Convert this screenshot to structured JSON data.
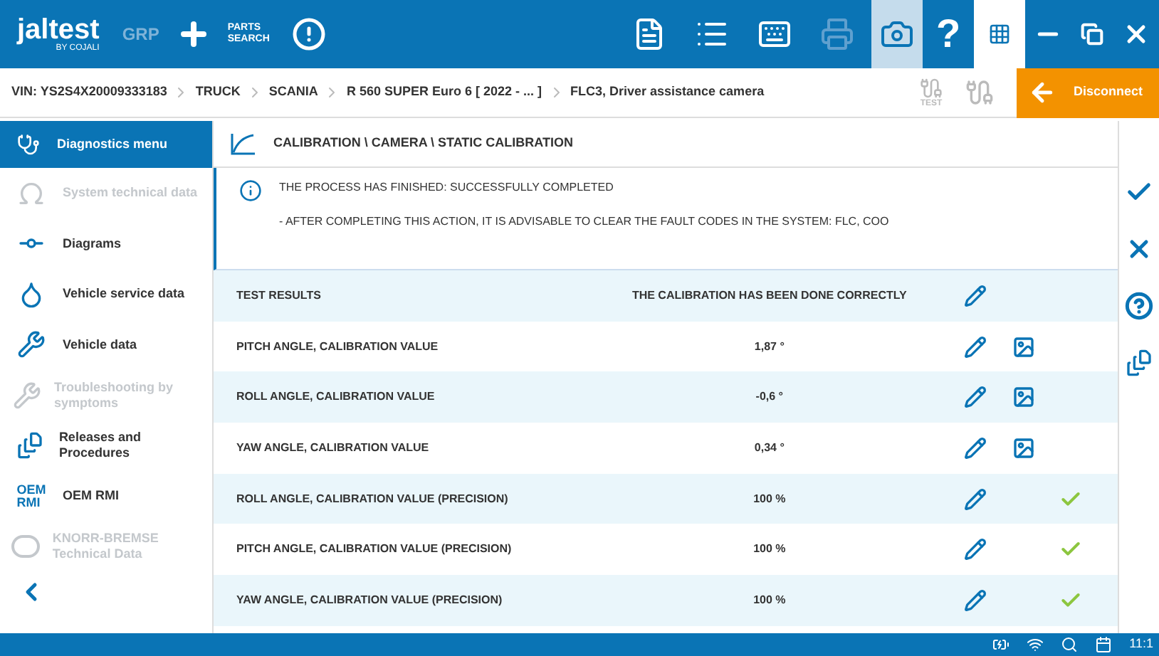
{
  "topbar": {
    "logo": "jaltest",
    "logo_sub": "BY COJALI",
    "grp": "GRP",
    "parts_search": [
      "PARTS",
      "SEARCH"
    ]
  },
  "breadcrumb": [
    "VIN: YS2S4X20009333183",
    "TRUCK",
    "SCANIA",
    "R 560 SUPER Euro 6 [ 2022 - ... ]",
    "FLC3, Driver assistance camera"
  ],
  "test_label": "TEST",
  "disconnect": "Disconnect",
  "sidebar": {
    "title": "Diagnostics menu",
    "items": [
      {
        "label": "System technical data",
        "disabled": true
      },
      {
        "label": "Diagrams",
        "disabled": false
      },
      {
        "label": "Vehicle service data",
        "disabled": false
      },
      {
        "label": "Vehicle data",
        "disabled": false
      },
      {
        "label": "Troubleshooting by symptoms",
        "disabled": true
      },
      {
        "label": "Releases and Procedures",
        "disabled": false
      },
      {
        "label": "OEM RMI",
        "icon_text": [
          "OEM",
          "RMI"
        ],
        "disabled": false
      },
      {
        "label": "KNORR-BREMSE Technical Data",
        "disabled": true
      }
    ]
  },
  "path": "CALIBRATION \\ CAMERA \\ STATIC CALIBRATION",
  "info": [
    "THE PROCESS HAS FINISHED: SUCCESSFULLY COMPLETED",
    "- AFTER COMPLETING THIS ACTION, IT IS ADVISABLE TO CLEAR THE FAULT CODES IN THE SYSTEM: FLC, COO"
  ],
  "results": [
    {
      "name": "TEST RESULTS",
      "value": "THE CALIBRATION HAS BEEN DONE CORRECTLY",
      "image": false,
      "passed": false
    },
    {
      "name": "PITCH ANGLE, CALIBRATION VALUE",
      "value": "1,87 °",
      "image": true,
      "passed": false
    },
    {
      "name": "ROLL ANGLE, CALIBRATION VALUE",
      "value": "-0,6 °",
      "image": true,
      "passed": false
    },
    {
      "name": "YAW ANGLE, CALIBRATION VALUE",
      "value": "0,34 °",
      "image": true,
      "passed": false
    },
    {
      "name": "ROLL ANGLE, CALIBRATION VALUE (PRECISION)",
      "value": "100 %",
      "image": false,
      "passed": true
    },
    {
      "name": "PITCH ANGLE, CALIBRATION VALUE (PRECISION)",
      "value": "100 %",
      "image": false,
      "passed": true
    },
    {
      "name": "YAW ANGLE, CALIBRATION VALUE (PRECISION)",
      "value": "100 %",
      "image": false,
      "passed": true
    }
  ],
  "right_toolbar": {
    "help": "?"
  },
  "taskbar": {
    "time": "11:1"
  }
}
